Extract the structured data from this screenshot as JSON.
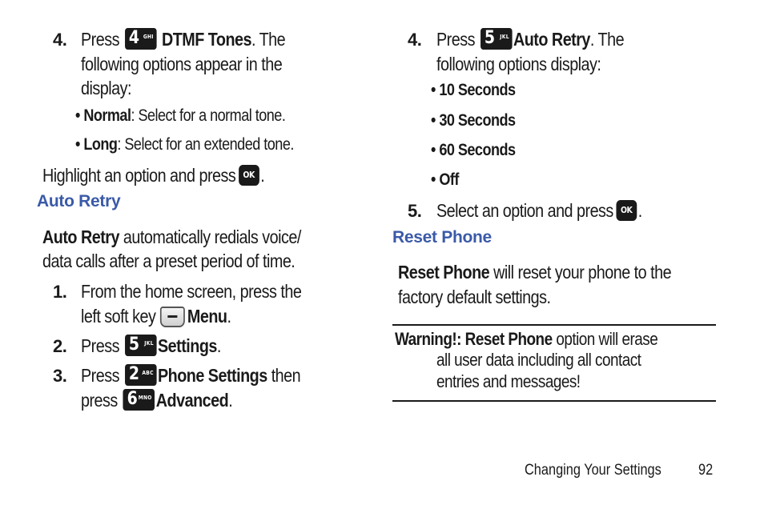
{
  "left": {
    "step4": {
      "number": "4.",
      "press": "Press",
      "key": {
        "digit": "4",
        "letters": "GHI",
        "icon": "key-4-icon"
      },
      "bold": "DTMF Tones",
      "rest": ". The",
      "line2": "following options appear in the",
      "line3": "display:"
    },
    "bullets": [
      {
        "label": "Normal",
        "desc": ": Select for a normal tone."
      },
      {
        "label": "Long",
        "desc": ": Select for an extended tone."
      }
    ],
    "highlight": {
      "text": "Highlight an option and press",
      "key": "OK",
      "end": "."
    },
    "section_heading": "Auto Retry",
    "intro": {
      "bold": "Auto Retry",
      "line1_rest": " automatically redials voice/",
      "line2": "data calls after a preset period of time."
    },
    "steps": [
      {
        "number": "1.",
        "line1": "From the home screen, press the",
        "line2_pre": "left soft key",
        "bold": "Menu",
        "end": "."
      },
      {
        "number": "2.",
        "press": "Press",
        "key": {
          "digit": "5",
          "letters": "JKL"
        },
        "bold": "Settings",
        "end": "."
      },
      {
        "number": "3.",
        "press": "Press",
        "key": {
          "digit": "2",
          "letters": "ABC"
        },
        "bold": "Phone Settings",
        "rest": " then",
        "line2_press": "press",
        "key2": {
          "digit": "6",
          "letters": "MNO"
        },
        "bold2": "Advanced",
        "end": "."
      }
    ]
  },
  "right": {
    "step4": {
      "number": "4.",
      "press": "Press",
      "key": {
        "digit": "5",
        "letters": "JKL"
      },
      "bold": "Auto Retry",
      "rest": ". The",
      "line2": "following options display:"
    },
    "options": [
      "10 Seconds",
      "30 Seconds",
      "60 Seconds",
      "Off"
    ],
    "step5": {
      "number": "5.",
      "text": "Select an option and press",
      "key": "OK",
      "end": "."
    },
    "section_heading": "Reset Phone",
    "intro": {
      "bold": "Reset Phone",
      "line1_rest": " will reset your phone to the",
      "line2": "factory default settings."
    },
    "warning": {
      "bold": "Warning!: Reset Phone",
      "line1_rest": " option will erase",
      "line2": "all user data including all contact",
      "line3": "entries and messages!"
    }
  },
  "footer": {
    "section": "Changing Your Settings",
    "page": "92"
  },
  "colors": {
    "heading": "#3a5aa8",
    "text": "#1a1a1a"
  }
}
